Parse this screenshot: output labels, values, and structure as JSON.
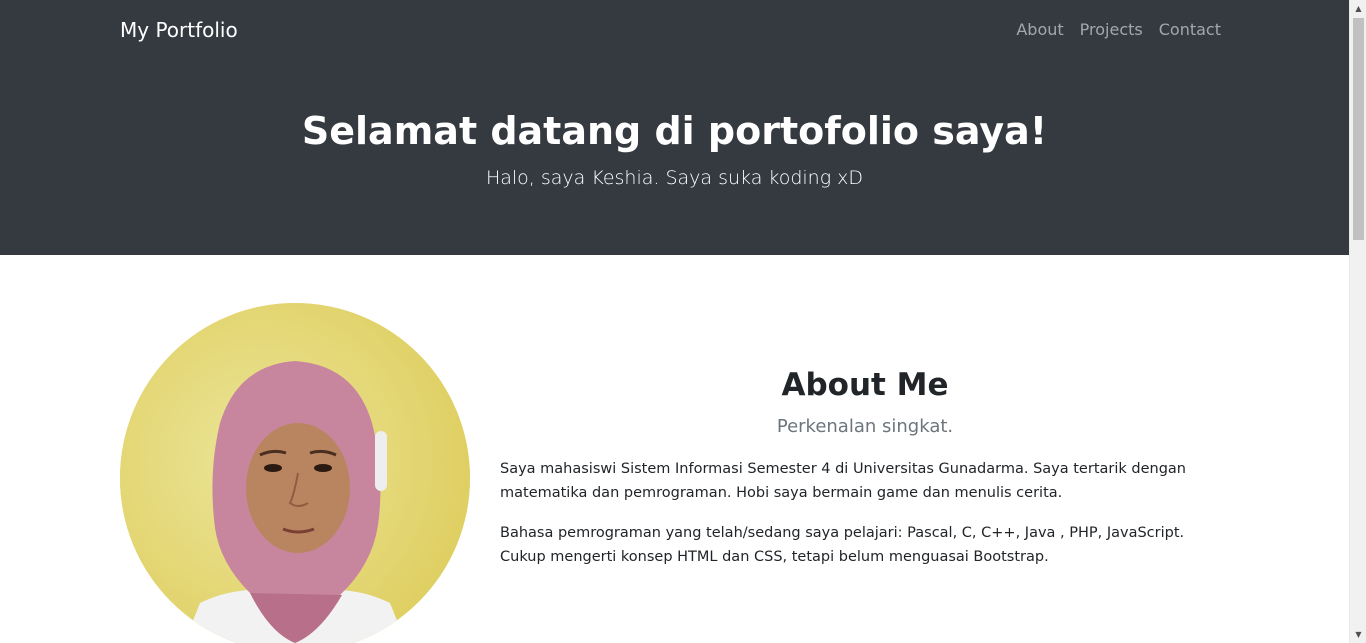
{
  "navbar": {
    "brand": "My Portfolio",
    "links": [
      "About",
      "Projects",
      "Contact"
    ]
  },
  "hero": {
    "title": "Selamat datang di portofolio saya!",
    "subtitle": "Halo, saya Keshia. Saya suka koding xD"
  },
  "about": {
    "title": "About Me",
    "lead": "Perkenalan singkat.",
    "paragraphs": [
      "Saya mahasiswi Sistem Informasi Semester 4 di Universitas Gunadarma. Saya tertarik dengan matematika dan pemrograman. Hobi saya bermain game dan menulis cerita.",
      "Bahasa pemrograman yang telah/sedang saya pelajari: Pascal, C, C++, Java , PHP, JavaScript. Cukup mengerti konsep HTML dan CSS, tetapi belum menguasai Bootstrap."
    ]
  },
  "colors": {
    "hero_bg": "#343a40",
    "nav_link": "rgba(255,255,255,0.55)",
    "lead_text": "#6c757d",
    "body_text": "#212529"
  }
}
